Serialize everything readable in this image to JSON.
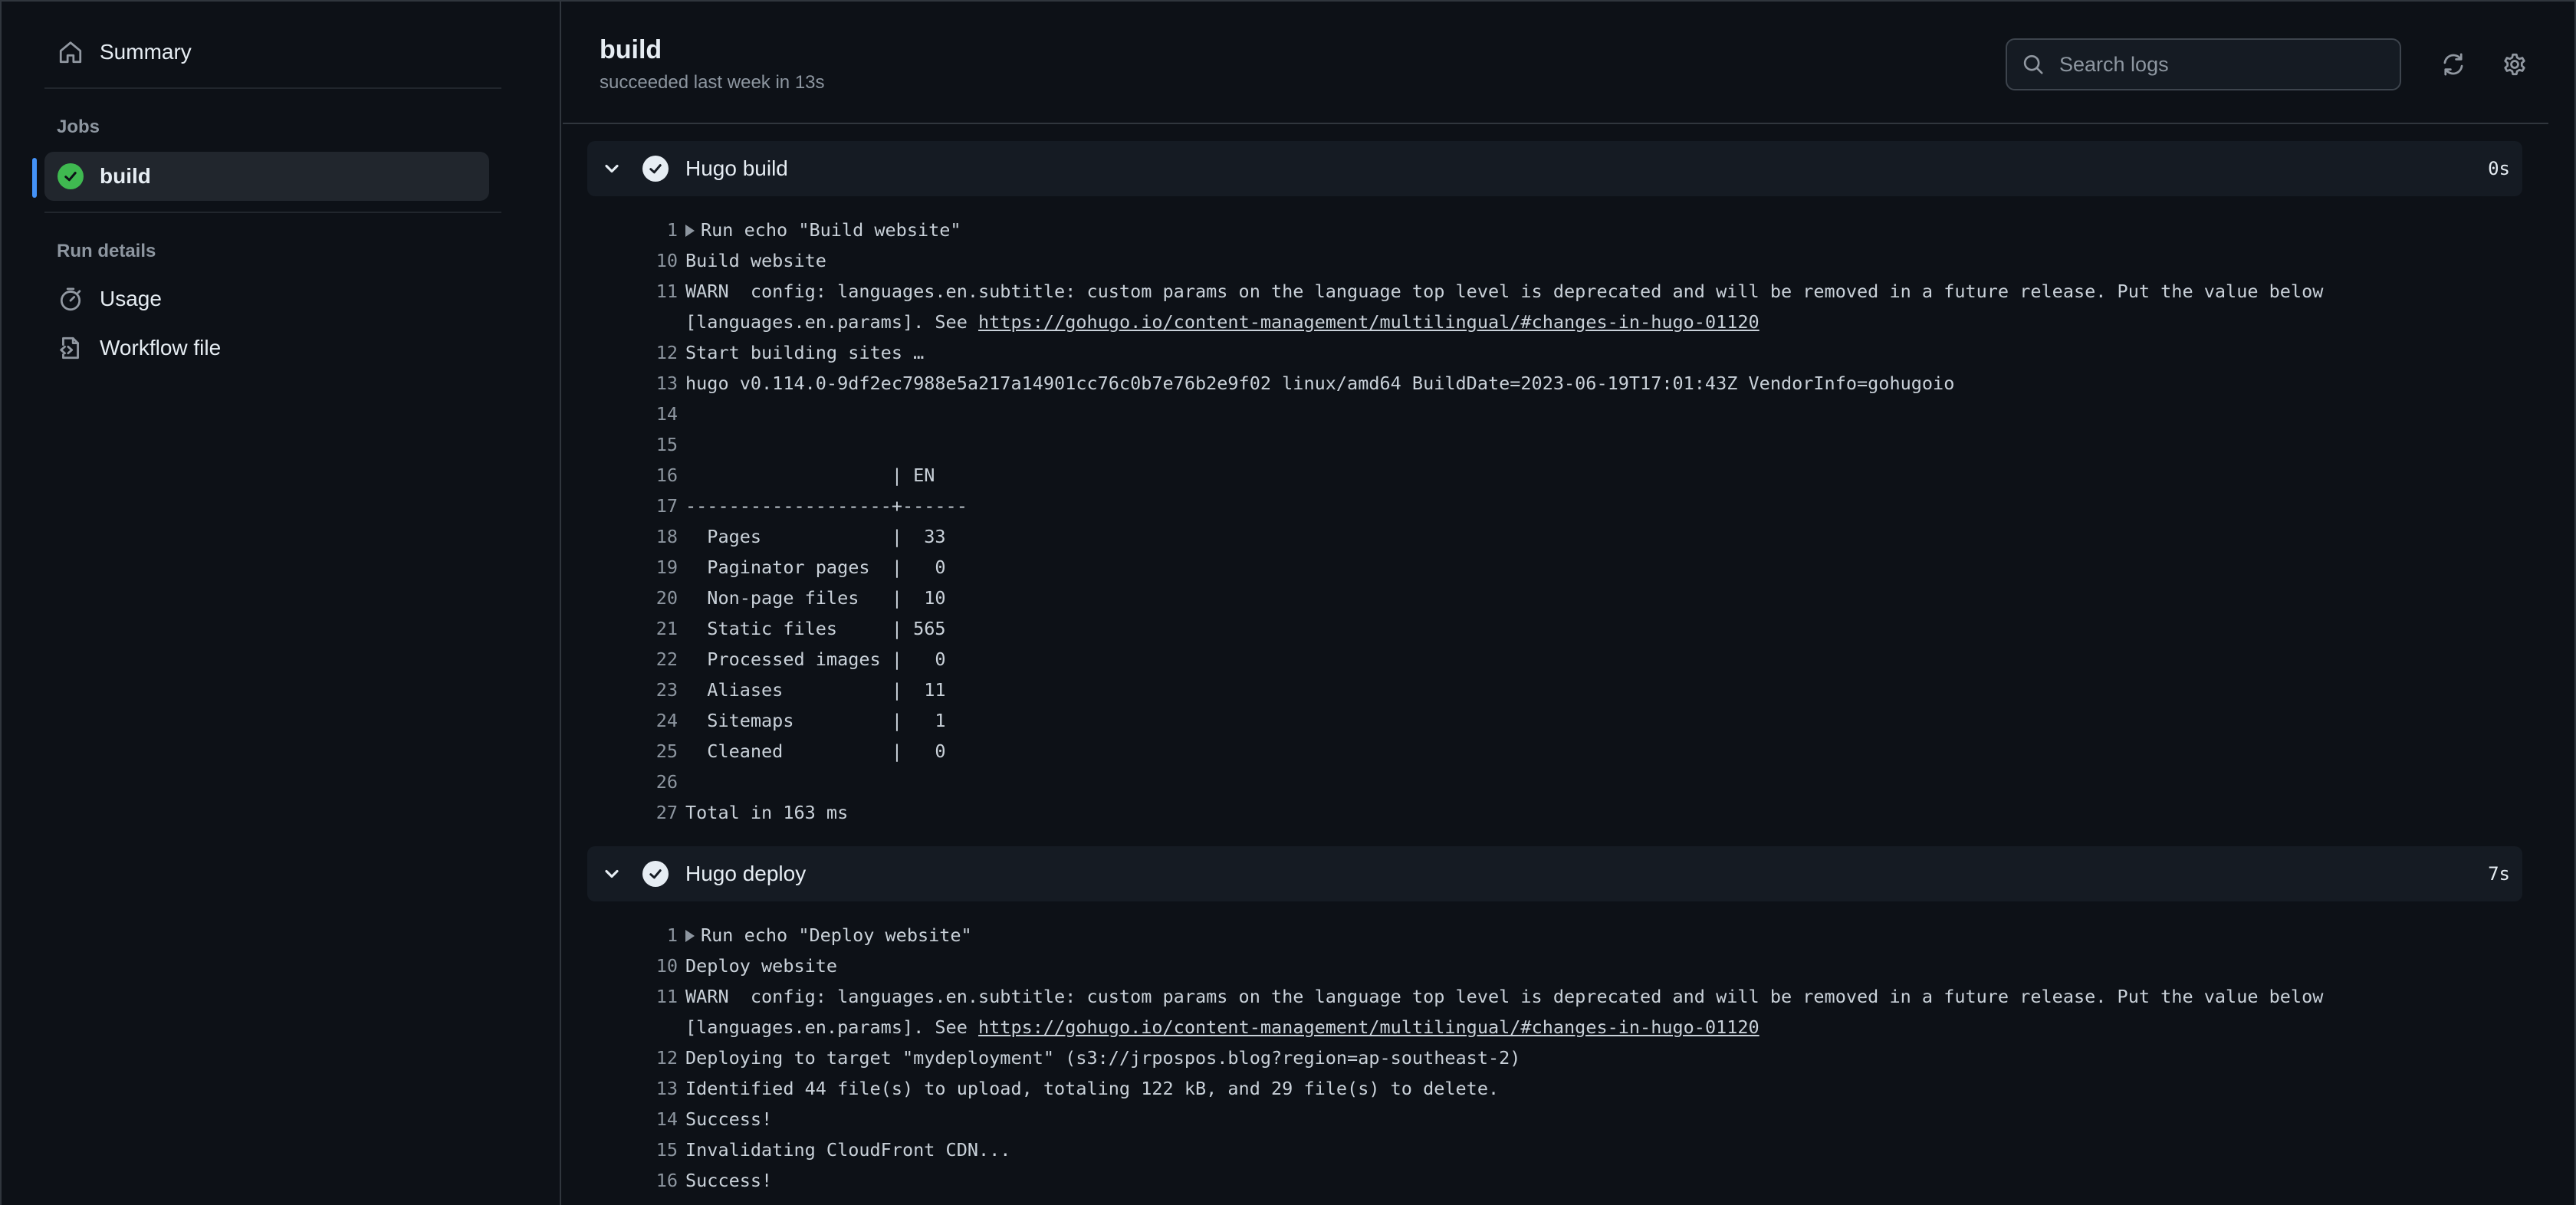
{
  "sidebar": {
    "summary_label": "Summary",
    "jobs_label": "Jobs",
    "job_item_label": "build",
    "run_details_label": "Run details",
    "usage_label": "Usage",
    "workflow_file_label": "Workflow file"
  },
  "header": {
    "title": "build",
    "subtitle": "succeeded last week in 13s",
    "search_placeholder": "Search logs"
  },
  "steps": [
    {
      "name": "Hugo build",
      "duration": "0s",
      "lines": [
        {
          "num": "1",
          "text": "Run echo \"Build website\"",
          "expandable": true
        },
        {
          "num": "10",
          "text": "Build website"
        },
        {
          "num": "11",
          "text": "WARN  config: languages.en.subtitle: custom params on the language top level is deprecated and will be removed in a future release. Put the value below",
          "text2_prefix": "[languages.en.params]. See ",
          "link": "https://gohugo.io/content-management/multilingual/#changes-in-hugo-01120"
        },
        {
          "num": "12",
          "text": "Start building sites …"
        },
        {
          "num": "13",
          "text": "hugo v0.114.0-9df2ec7988e5a217a14901cc76c0b7e76b2e9f02 linux/amd64 BuildDate=2023-06-19T17:01:43Z VendorInfo=gohugoio"
        },
        {
          "num": "14",
          "text": ""
        },
        {
          "num": "15",
          "text": ""
        },
        {
          "num": "16",
          "text": "                   | EN"
        },
        {
          "num": "17",
          "text": "-------------------+------"
        },
        {
          "num": "18",
          "text": "  Pages            |  33"
        },
        {
          "num": "19",
          "text": "  Paginator pages  |   0"
        },
        {
          "num": "20",
          "text": "  Non-page files   |  10"
        },
        {
          "num": "21",
          "text": "  Static files     | 565"
        },
        {
          "num": "22",
          "text": "  Processed images |   0"
        },
        {
          "num": "23",
          "text": "  Aliases          |  11"
        },
        {
          "num": "24",
          "text": "  Sitemaps         |   1"
        },
        {
          "num": "25",
          "text": "  Cleaned          |   0"
        },
        {
          "num": "26",
          "text": ""
        },
        {
          "num": "27",
          "text": "Total in 163 ms"
        }
      ]
    },
    {
      "name": "Hugo deploy",
      "duration": "7s",
      "lines": [
        {
          "num": "1",
          "text": "Run echo \"Deploy website\"",
          "expandable": true
        },
        {
          "num": "10",
          "text": "Deploy website"
        },
        {
          "num": "11",
          "text": "WARN  config: languages.en.subtitle: custom params on the language top level is deprecated and will be removed in a future release. Put the value below",
          "text2_prefix": "[languages.en.params]. See ",
          "link": "https://gohugo.io/content-management/multilingual/#changes-in-hugo-01120"
        },
        {
          "num": "12",
          "text": "Deploying to target \"mydeployment\" (s3://jrpospos.blog?region=ap-southeast-2)"
        },
        {
          "num": "13",
          "text": "Identified 44 file(s) to upload, totaling 122 kB, and 29 file(s) to delete."
        },
        {
          "num": "14",
          "text": "Success!"
        },
        {
          "num": "15",
          "text": "Invalidating CloudFront CDN..."
        },
        {
          "num": "16",
          "text": "Success!"
        }
      ]
    }
  ],
  "colors": {
    "background": "#0d1117",
    "success": "#3fb950",
    "accent": "#4493f8"
  },
  "icons": [
    "home-icon",
    "check-circle-icon",
    "stopwatch-icon",
    "workflow-file-icon",
    "search-icon",
    "refresh-icon",
    "gear-icon",
    "chevron-down-icon"
  ]
}
